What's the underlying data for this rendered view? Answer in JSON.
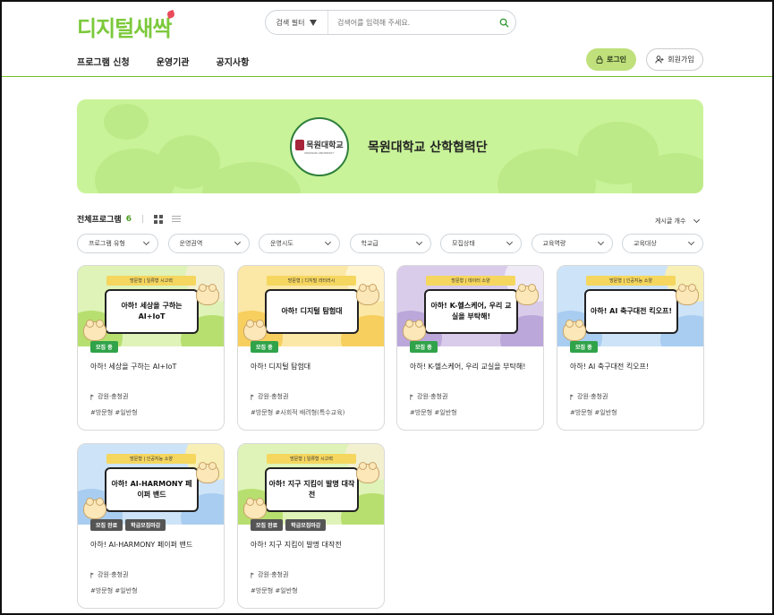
{
  "logo": "디지털새싹",
  "search": {
    "filter_label": "검색 필터",
    "placeholder": "검색어를 입력해 주세요."
  },
  "nav": [
    {
      "label": "프로그램 신청"
    },
    {
      "label": "운영기관"
    },
    {
      "label": "공지사항"
    }
  ],
  "auth": {
    "login": "로그인",
    "join": "회원가입"
  },
  "banner": {
    "org_logo_text": "목원대학교",
    "org_logo_sub": "MOKWON UNIVERSITY",
    "title": "목원대학교 산학협력단"
  },
  "list": {
    "heading": "전체프로그램",
    "count": "6",
    "sort_label": "게시글 개수"
  },
  "filters": [
    "프로그램 유형",
    "운영권역",
    "운영시도",
    "학교급",
    "모집상태",
    "교육역량",
    "교육대상"
  ],
  "cards": [
    {
      "ribbon": "방문형 | 일류형 시고력",
      "panel": "아하! 세상을 구하는 AI+IoT",
      "badges": [
        {
          "text": "모집 중",
          "kind": "open"
        }
      ],
      "name": "아하! 세상을 구하는 AI+IoT",
      "location": "강원·충청권",
      "tags": "#방문형 #일반형",
      "theme": "green"
    },
    {
      "ribbon": "방문형 | 디지털 리터러시",
      "panel": "아하! 디지털 탐험대",
      "badges": [
        {
          "text": "모집 중",
          "kind": "open"
        }
      ],
      "name": "아하! 디지털 탐험대",
      "location": "강원·충청권",
      "tags": "#방문형 #사회적 배려형(특수교육)",
      "theme": "yellow"
    },
    {
      "ribbon": "방문형 | 데이터 소양",
      "panel": "아하! K-헬스케어, 우리 교실을 부탁해!",
      "badges": [
        {
          "text": "모집 중",
          "kind": "open"
        }
      ],
      "name": "아하! K-헬스케어, 우리 교실을 부탁해!",
      "location": "강원·충청권",
      "tags": "#방문형 #일반형",
      "theme": "purple"
    },
    {
      "ribbon": "방문형 | 인공지능 소양",
      "panel": "아하! AI 축구대전 킥오프!",
      "badges": [
        {
          "text": "모집 중",
          "kind": "open"
        }
      ],
      "name": "아하! AI 축구대전 킥오프!",
      "location": "강원·충청권",
      "tags": "#방문형 #일반형",
      "theme": "blue"
    },
    {
      "ribbon": "방문형 | 인공지능 소양",
      "panel": "아하! AI-HARMONY 페이퍼 밴드",
      "badges": [
        {
          "text": "모집 완료",
          "kind": "closed"
        },
        {
          "text": "학급모집마감",
          "kind": "closed"
        }
      ],
      "name": "아하! AI-HARMONY 페이퍼 밴드",
      "location": "강원·충청권",
      "tags": "#방문형 #일반형",
      "theme": "blue"
    },
    {
      "ribbon": "방문형 | 일류형 시고력",
      "panel": "아하! 지구 지킴이 발명 대작전",
      "badges": [
        {
          "text": "모집 완료",
          "kind": "closed"
        },
        {
          "text": "학급모집마감",
          "kind": "closed"
        }
      ],
      "name": "아하! 지구 지킴이 발명 대작전",
      "location": "강원·충청권",
      "tags": "#방문형 #일반형",
      "theme": "green"
    }
  ],
  "colors": {
    "accent": "#6fbf2e",
    "banner_bg": "#c9f399",
    "login_bg": "#bfe07b",
    "badge_open": "#30a34a",
    "badge_closed": "#555555"
  }
}
